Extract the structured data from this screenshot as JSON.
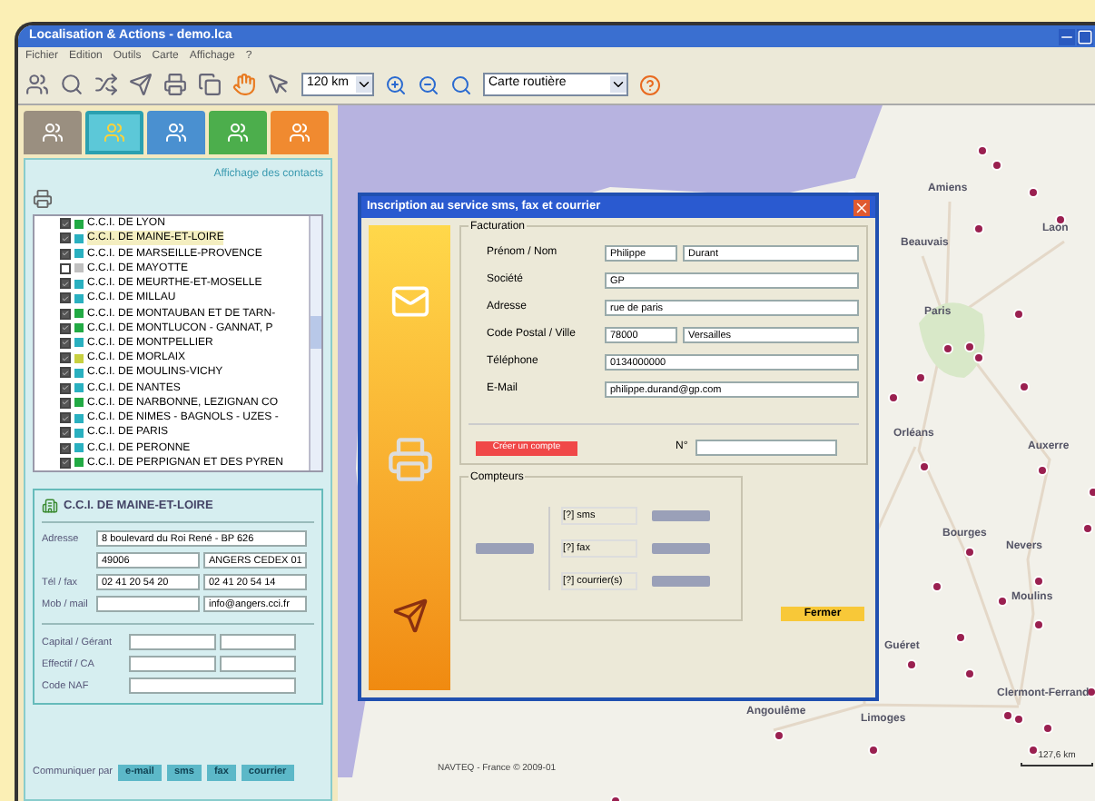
{
  "window": {
    "title": "Localisation & Actions - demo.lca"
  },
  "menu": [
    "Fichier",
    "Edition",
    "Outils",
    "Carte",
    "Affichage",
    "?"
  ],
  "toolbar": {
    "scale_select": {
      "value": "120 km"
    },
    "map_select": {
      "value": "Carte routière"
    }
  },
  "sidebar": {
    "tabs": [
      {
        "selected": false,
        "color": "#9a8f80"
      },
      {
        "selected": true,
        "color": "#5cc8d8"
      },
      {
        "selected": false,
        "color": "#4a90d0"
      },
      {
        "selected": false,
        "color": "#4cae4c"
      },
      {
        "selected": false,
        "color": "#f08a30"
      }
    ],
    "contacts": {
      "heading": "Affichage des contacts",
      "items": [
        {
          "label": "C.C.I. DE LYON",
          "checked": true,
          "selected": false,
          "color": "#22aa44"
        },
        {
          "label": "C.C.I. DE MAINE-ET-LOIRE",
          "checked": true,
          "selected": true,
          "color": "#2ab0c0"
        },
        {
          "label": "C.C.I. DE MARSEILLE-PROVENCE",
          "checked": true,
          "selected": false,
          "color": "#2ab0c0"
        },
        {
          "label": "C.C.I. DE MAYOTTE",
          "checked": false,
          "selected": false,
          "color": "#c0c0c0"
        },
        {
          "label": "C.C.I. DE MEURTHE-ET-MOSELLE",
          "checked": true,
          "selected": false,
          "color": "#2ab0c0"
        },
        {
          "label": "C.C.I. DE MILLAU",
          "checked": true,
          "selected": false,
          "color": "#2ab0c0"
        },
        {
          "label": "C.C.I. DE MONTAUBAN ET DE TARN-",
          "checked": true,
          "selected": false,
          "color": "#22aa44"
        },
        {
          "label": "C.C.I. DE MONTLUCON - GANNAT, P",
          "checked": true,
          "selected": false,
          "color": "#22aa44"
        },
        {
          "label": "C.C.I. DE MONTPELLIER",
          "checked": true,
          "selected": false,
          "color": "#2ab0c0"
        },
        {
          "label": "C.C.I. DE MORLAIX",
          "checked": true,
          "selected": false,
          "color": "#c8d040"
        },
        {
          "label": "C.C.I. DE MOULINS-VICHY",
          "checked": true,
          "selected": false,
          "color": "#2ab0c0"
        },
        {
          "label": "C.C.I. DE NANTES",
          "checked": true,
          "selected": false,
          "color": "#2ab0c0"
        },
        {
          "label": "C.C.I. DE NARBONNE, LEZIGNAN CO",
          "checked": true,
          "selected": false,
          "color": "#22aa44"
        },
        {
          "label": "C.C.I. DE NIMES - BAGNOLS - UZES -",
          "checked": true,
          "selected": false,
          "color": "#2ab0c0"
        },
        {
          "label": "C.C.I. DE PARIS",
          "checked": true,
          "selected": false,
          "color": "#2ab0c0"
        },
        {
          "label": "C.C.I. DE PERONNE",
          "checked": true,
          "selected": false,
          "color": "#2ab0c0"
        },
        {
          "label": "C.C.I. DE PERPIGNAN ET DES PYREN",
          "checked": true,
          "selected": false,
          "color": "#22aa44"
        }
      ]
    },
    "details": {
      "title": "C.C.I. DE MAINE-ET-LOIRE",
      "rows": [
        {
          "label": "Adresse",
          "cells": [
            {
              "value": "8 boulevard du Roi René - BP 626"
            }
          ]
        },
        {
          "cells": [
            {
              "value": "49006"
            },
            {
              "value": "ANGERS CEDEX 01"
            }
          ]
        },
        {
          "label": "Tél / fax",
          "cells": [
            {
              "value": "02 41 20 54 20"
            },
            {
              "value": "02 41 20 54 14"
            }
          ]
        },
        {
          "label": "Mob / mail",
          "cells": [
            {},
            {
              "value": "info@angers.cci.fr"
            }
          ]
        }
      ],
      "extra_rows": [
        {
          "label": "Capital / Gérant",
          "cells": [
            {},
            {}
          ]
        },
        {
          "label": "Effectif / CA",
          "cells": [
            {},
            {}
          ]
        },
        {
          "label": "Code NAF",
          "cells": [
            {}
          ]
        }
      ]
    },
    "communicate": {
      "label": "Communiquer par",
      "buttons": [
        "e-mail",
        "sms",
        "fax",
        "courrier"
      ]
    }
  },
  "dialog": {
    "title": "Inscription au service sms, fax et courrier",
    "billing": {
      "legend": "Facturation",
      "rows": [
        {
          "label": "Prénom / Nom",
          "values": [
            "Philippe",
            "Durant"
          ]
        },
        {
          "label": "Société",
          "values": [
            "GP"
          ]
        },
        {
          "label": "Adresse",
          "values": [
            "rue de paris"
          ]
        },
        {
          "label": "Code Postal / Ville",
          "values": [
            "78000",
            "Versailles"
          ]
        },
        {
          "label": "Téléphone",
          "values": [
            "0134000000"
          ]
        },
        {
          "label": "E-Mail",
          "values": [
            "philippe.durand@gp.com"
          ]
        }
      ],
      "create_button": "Créer un compte",
      "number_label": "N°"
    },
    "counters": {
      "legend": "Compteurs",
      "readouts": [
        "[?] sms",
        "[?] fax",
        "[?] courrier(s)"
      ]
    },
    "close_button": "Fermer"
  },
  "map": {
    "cities": [
      {
        "name": "Amiens"
      },
      {
        "name": "Laon"
      },
      {
        "name": "Beauvais"
      },
      {
        "name": "Paris"
      },
      {
        "name": "Orléans"
      },
      {
        "name": "Auxerre"
      },
      {
        "name": "Bourges"
      },
      {
        "name": "Nevers"
      },
      {
        "name": "Moulins"
      },
      {
        "name": "Guéret"
      },
      {
        "name": "Limoges"
      },
      {
        "name": "Clermont-Ferrand"
      },
      {
        "name": "Angoulême"
      }
    ],
    "scale": "127,6 km",
    "copyright": "NAVTEQ - France © 2009-01"
  }
}
